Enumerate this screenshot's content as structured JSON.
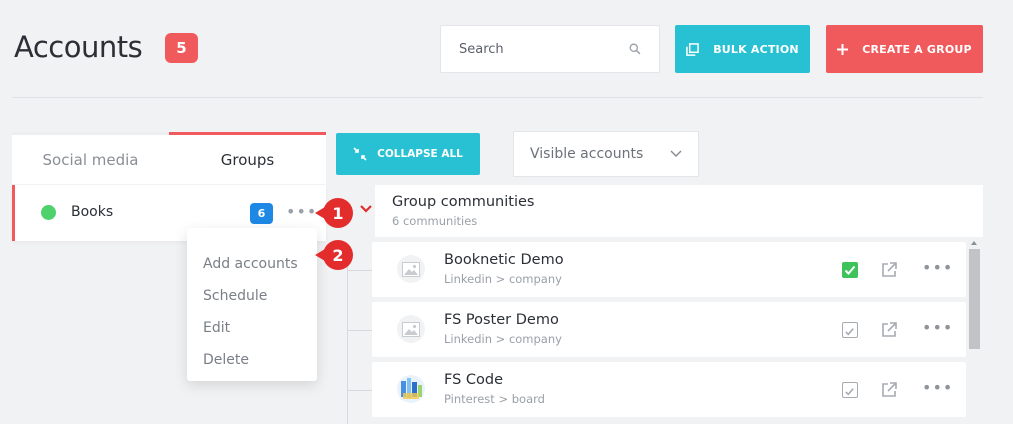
{
  "header": {
    "title": "Accounts",
    "count": "5",
    "search_placeholder": "Search",
    "bulk_action_label": "BULK ACTION",
    "create_group_label": "CREATE A GROUP"
  },
  "tabs": [
    {
      "label": "Social media",
      "active": false
    },
    {
      "label": "Groups",
      "active": true
    }
  ],
  "group": {
    "name": "Books",
    "count": "6",
    "status_color": "#4fd26b"
  },
  "context_menu": {
    "items": [
      "Add accounts",
      "Schedule",
      "Edit",
      "Delete"
    ]
  },
  "callouts": [
    "1",
    "2"
  ],
  "toolbar": {
    "collapse_all_label": "COLLAPSE ALL",
    "visible_accounts_label": "Visible accounts"
  },
  "group_communities": {
    "title": "Group communities",
    "subtitle": "6 communities"
  },
  "accounts": [
    {
      "name": "Booknetic Demo",
      "sub": "Linkedin > company",
      "checked": true,
      "thumb": "image-placeholder-icon"
    },
    {
      "name": "FS Poster Demo",
      "sub": "Linkedin > company",
      "checked": false,
      "thumb": "image-placeholder-icon"
    },
    {
      "name": "FS Code",
      "sub": "Pinterest > board",
      "checked": false,
      "thumb": "colorful-avatar-icon"
    }
  ],
  "colors": {
    "accent_red": "#f05a5c",
    "accent_cyan": "#28c1d3",
    "callout_red": "#e32d2d",
    "count_blue": "#1e88e5",
    "check_green": "#3ec35b"
  }
}
